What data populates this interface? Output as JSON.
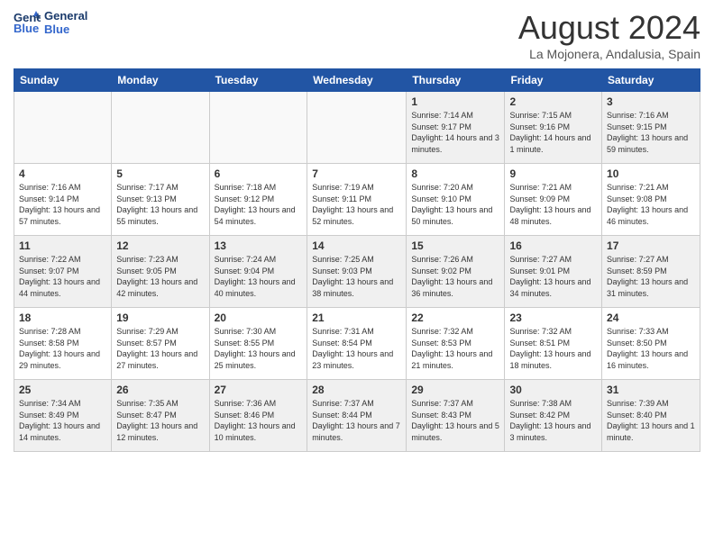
{
  "header": {
    "logo_line1": "General",
    "logo_line2": "Blue",
    "month_year": "August 2024",
    "location": "La Mojonera, Andalusia, Spain"
  },
  "weekdays": [
    "Sunday",
    "Monday",
    "Tuesday",
    "Wednesday",
    "Thursday",
    "Friday",
    "Saturday"
  ],
  "weeks": [
    [
      {
        "day": "",
        "empty": true
      },
      {
        "day": "",
        "empty": true
      },
      {
        "day": "",
        "empty": true
      },
      {
        "day": "",
        "empty": true
      },
      {
        "day": "1",
        "sunrise": "7:14 AM",
        "sunset": "9:17 PM",
        "daylight": "14 hours and 3 minutes."
      },
      {
        "day": "2",
        "sunrise": "7:15 AM",
        "sunset": "9:16 PM",
        "daylight": "14 hours and 1 minute."
      },
      {
        "day": "3",
        "sunrise": "7:16 AM",
        "sunset": "9:15 PM",
        "daylight": "13 hours and 59 minutes."
      }
    ],
    [
      {
        "day": "4",
        "sunrise": "7:16 AM",
        "sunset": "9:14 PM",
        "daylight": "13 hours and 57 minutes."
      },
      {
        "day": "5",
        "sunrise": "7:17 AM",
        "sunset": "9:13 PM",
        "daylight": "13 hours and 55 minutes."
      },
      {
        "day": "6",
        "sunrise": "7:18 AM",
        "sunset": "9:12 PM",
        "daylight": "13 hours and 54 minutes."
      },
      {
        "day": "7",
        "sunrise": "7:19 AM",
        "sunset": "9:11 PM",
        "daylight": "13 hours and 52 minutes."
      },
      {
        "day": "8",
        "sunrise": "7:20 AM",
        "sunset": "9:10 PM",
        "daylight": "13 hours and 50 minutes."
      },
      {
        "day": "9",
        "sunrise": "7:21 AM",
        "sunset": "9:09 PM",
        "daylight": "13 hours and 48 minutes."
      },
      {
        "day": "10",
        "sunrise": "7:21 AM",
        "sunset": "9:08 PM",
        "daylight": "13 hours and 46 minutes."
      }
    ],
    [
      {
        "day": "11",
        "sunrise": "7:22 AM",
        "sunset": "9:07 PM",
        "daylight": "13 hours and 44 minutes."
      },
      {
        "day": "12",
        "sunrise": "7:23 AM",
        "sunset": "9:05 PM",
        "daylight": "13 hours and 42 minutes."
      },
      {
        "day": "13",
        "sunrise": "7:24 AM",
        "sunset": "9:04 PM",
        "daylight": "13 hours and 40 minutes."
      },
      {
        "day": "14",
        "sunrise": "7:25 AM",
        "sunset": "9:03 PM",
        "daylight": "13 hours and 38 minutes."
      },
      {
        "day": "15",
        "sunrise": "7:26 AM",
        "sunset": "9:02 PM",
        "daylight": "13 hours and 36 minutes."
      },
      {
        "day": "16",
        "sunrise": "7:27 AM",
        "sunset": "9:01 PM",
        "daylight": "13 hours and 34 minutes."
      },
      {
        "day": "17",
        "sunrise": "7:27 AM",
        "sunset": "8:59 PM",
        "daylight": "13 hours and 31 minutes."
      }
    ],
    [
      {
        "day": "18",
        "sunrise": "7:28 AM",
        "sunset": "8:58 PM",
        "daylight": "13 hours and 29 minutes."
      },
      {
        "day": "19",
        "sunrise": "7:29 AM",
        "sunset": "8:57 PM",
        "daylight": "13 hours and 27 minutes."
      },
      {
        "day": "20",
        "sunrise": "7:30 AM",
        "sunset": "8:55 PM",
        "daylight": "13 hours and 25 minutes."
      },
      {
        "day": "21",
        "sunrise": "7:31 AM",
        "sunset": "8:54 PM",
        "daylight": "13 hours and 23 minutes."
      },
      {
        "day": "22",
        "sunrise": "7:32 AM",
        "sunset": "8:53 PM",
        "daylight": "13 hours and 21 minutes."
      },
      {
        "day": "23",
        "sunrise": "7:32 AM",
        "sunset": "8:51 PM",
        "daylight": "13 hours and 18 minutes."
      },
      {
        "day": "24",
        "sunrise": "7:33 AM",
        "sunset": "8:50 PM",
        "daylight": "13 hours and 16 minutes."
      }
    ],
    [
      {
        "day": "25",
        "sunrise": "7:34 AM",
        "sunset": "8:49 PM",
        "daylight": "13 hours and 14 minutes."
      },
      {
        "day": "26",
        "sunrise": "7:35 AM",
        "sunset": "8:47 PM",
        "daylight": "13 hours and 12 minutes."
      },
      {
        "day": "27",
        "sunrise": "7:36 AM",
        "sunset": "8:46 PM",
        "daylight": "13 hours and 10 minutes."
      },
      {
        "day": "28",
        "sunrise": "7:37 AM",
        "sunset": "8:44 PM",
        "daylight": "13 hours and 7 minutes."
      },
      {
        "day": "29",
        "sunrise": "7:37 AM",
        "sunset": "8:43 PM",
        "daylight": "13 hours and 5 minutes."
      },
      {
        "day": "30",
        "sunrise": "7:38 AM",
        "sunset": "8:42 PM",
        "daylight": "13 hours and 3 minutes."
      },
      {
        "day": "31",
        "sunrise": "7:39 AM",
        "sunset": "8:40 PM",
        "daylight": "13 hours and 1 minute."
      }
    ]
  ]
}
